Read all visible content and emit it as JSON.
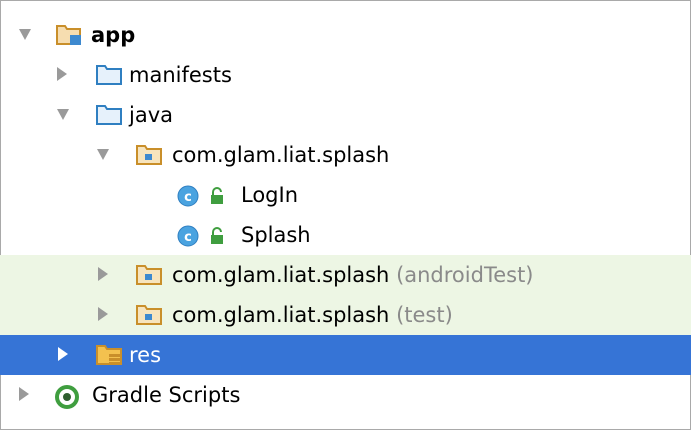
{
  "tree": {
    "app": {
      "label": "app"
    },
    "manifests": {
      "label": "manifests"
    },
    "java": {
      "label": "java"
    },
    "pkg_main": {
      "label": "com.glam.liat.splash"
    },
    "login": {
      "label": "LogIn"
    },
    "splash": {
      "label": "Splash"
    },
    "pkg_android_test": {
      "label": "com.glam.liat.splash",
      "suffix": "(androidTest)"
    },
    "pkg_test": {
      "label": "com.glam.liat.splash",
      "suffix": "(test)"
    },
    "res": {
      "label": "res"
    },
    "gradle": {
      "label": "Gradle Scripts"
    }
  },
  "colors": {
    "selection": "#3674d6",
    "test_background": "#edf6e4",
    "folder_blue": "#2f7fc1",
    "folder_orange": "#d9a341",
    "class_badge": "#4aa3e0",
    "lock_green": "#3f9e3f",
    "gradle_green": "#3f9e3f"
  },
  "icons": [
    "expand-arrow-icon",
    "collapse-arrow-icon",
    "module-folder-icon",
    "folder-icon",
    "package-icon",
    "class-icon",
    "lock-icon",
    "resources-folder-icon",
    "gradle-icon"
  ]
}
